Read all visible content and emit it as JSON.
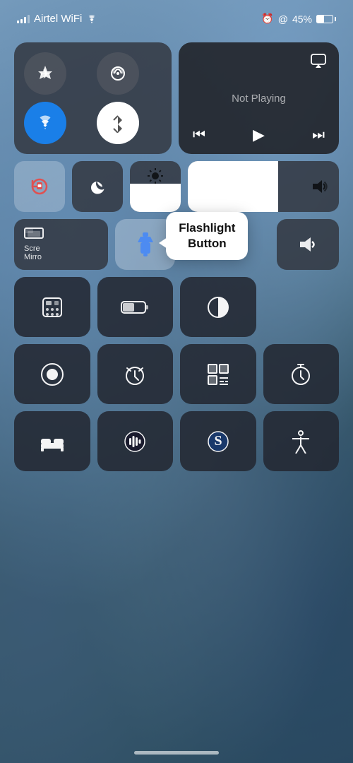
{
  "status": {
    "carrier": "Airtel WiFi",
    "battery_pct": "45%",
    "alarm_icon": "⏰",
    "location_icon": "@"
  },
  "now_playing": {
    "label": "Not Playing"
  },
  "screen_mirror": {
    "line1": "Scre",
    "line2": "Mirro"
  },
  "tooltip": {
    "text": "Flashlight\nButton"
  },
  "home_indicator": true
}
